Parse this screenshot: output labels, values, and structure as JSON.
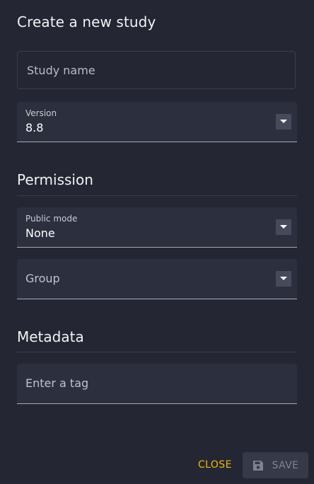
{
  "dialog": {
    "title": "Create a new study"
  },
  "study_name": {
    "placeholder": "Study name"
  },
  "version": {
    "label": "Version",
    "value": "8.8"
  },
  "permission": {
    "title": "Permission",
    "public_mode": {
      "label": "Public mode",
      "value": "None"
    },
    "group": {
      "placeholder": "Group"
    }
  },
  "metadata": {
    "title": "Metadata",
    "tag_input": {
      "placeholder": "Enter a tag"
    }
  },
  "actions": {
    "close_label": "CLOSE",
    "save_label": "SAVE",
    "save_icon": "save-icon"
  },
  "colors": {
    "background": "#242634",
    "accent": "#f0b90b",
    "field_fill": "#2c2f3e",
    "disabled": "#80838f"
  }
}
